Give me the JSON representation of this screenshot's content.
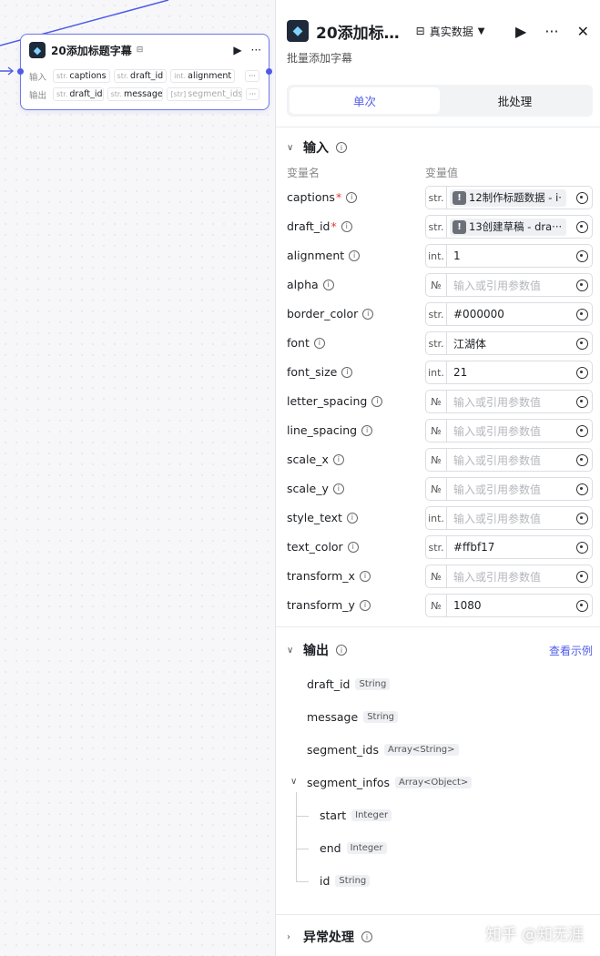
{
  "canvas": {
    "node": {
      "title": "20添加标题字幕",
      "input_label": "输入",
      "output_label": "输出",
      "inputs": [
        {
          "type": "str.",
          "name": "captions"
        },
        {
          "type": "str.",
          "name": "draft_id"
        },
        {
          "type": "int.",
          "name": "alignment"
        }
      ],
      "outputs": [
        {
          "type": "str.",
          "name": "draft_id"
        },
        {
          "type": "str.",
          "name": "message"
        },
        {
          "type": "[str]",
          "name": "segment_ids"
        }
      ],
      "more": "···"
    }
  },
  "panel": {
    "title": "20添加标…",
    "data_source": "真实数据",
    "subtitle": "批量添加字幕",
    "tabs": [
      "单次",
      "批处理"
    ],
    "input_section": "输入",
    "col_name": "变量名",
    "col_value": "变量值",
    "params": [
      {
        "name": "captions",
        "required": true,
        "type": "str.",
        "ref": "12制作标题数据 - i·",
        "ref_icon": "!"
      },
      {
        "name": "draft_id",
        "required": true,
        "type": "str.",
        "ref": "13创建草稿 - dra···",
        "ref_icon": "!"
      },
      {
        "name": "alignment",
        "type": "int.",
        "value": "1"
      },
      {
        "name": "alpha",
        "type": "№",
        "placeholder": "输入或引用参数值"
      },
      {
        "name": "border_color",
        "type": "str.",
        "value": "#000000"
      },
      {
        "name": "font",
        "type": "str.",
        "value": "江湖体"
      },
      {
        "name": "font_size",
        "type": "int.",
        "value": "21"
      },
      {
        "name": "letter_spacing",
        "type": "№",
        "placeholder": "输入或引用参数值"
      },
      {
        "name": "line_spacing",
        "type": "№",
        "placeholder": "输入或引用参数值"
      },
      {
        "name": "scale_x",
        "type": "№",
        "placeholder": "输入或引用参数值"
      },
      {
        "name": "scale_y",
        "type": "№",
        "placeholder": "输入或引用参数值"
      },
      {
        "name": "style_text",
        "type": "int.",
        "placeholder": "输入或引用参数值"
      },
      {
        "name": "text_color",
        "type": "str.",
        "value": "#ffbf17"
      },
      {
        "name": "transform_x",
        "type": "№",
        "placeholder": "输入或引用参数值"
      },
      {
        "name": "transform_y",
        "type": "№",
        "value": "1080"
      }
    ],
    "output_section": "输出",
    "view_example": "查看示例",
    "outputs": [
      {
        "name": "draft_id",
        "type": "String"
      },
      {
        "name": "message",
        "type": "String"
      },
      {
        "name": "segment_ids",
        "type": "Array<String>"
      },
      {
        "name": "segment_infos",
        "type": "Array<Object>"
      }
    ],
    "segment_children": [
      {
        "name": "start",
        "type": "Integer"
      },
      {
        "name": "end",
        "type": "Integer"
      },
      {
        "name": "id",
        "type": "String"
      }
    ],
    "error_section": "异常处理"
  },
  "watermark": "知乎 @知无涯",
  "colors": {
    "accent": "#4e5be8",
    "required": "#e53935"
  }
}
